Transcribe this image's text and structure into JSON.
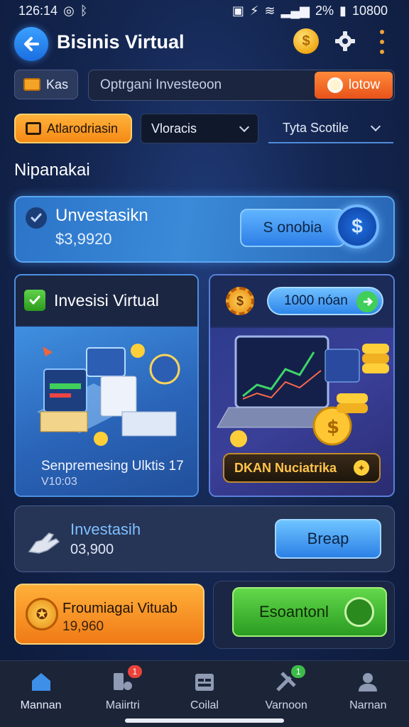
{
  "status_bar": {
    "time": "126:14",
    "battery": "2%",
    "extra": "10800"
  },
  "header": {
    "title": "Bisinis Virtual"
  },
  "search": {
    "chip_label": "Kas",
    "placeholder": "Optrgani Investeoon",
    "button_label": "lotow"
  },
  "filters": {
    "primary": "Atlarodriasin",
    "dropdown_1": "Vloracis",
    "dropdown_2": "Tyta Scotile"
  },
  "section": {
    "title": "Nipanakai"
  },
  "featured": {
    "title": "Unvestasikn",
    "amount": "$3,9920",
    "button_label": "S onobia"
  },
  "card_left": {
    "title": "Invesisi Virtual",
    "caption": "Senpremesing Ulktis 17",
    "sub": "V10:03"
  },
  "card_right": {
    "pill_label": "1000 nóan",
    "action_label": "DKAN Nuciatrika"
  },
  "investment": {
    "title": "Investasih",
    "amount": "03,900",
    "button_label": "Breap"
  },
  "promo": {
    "title": "Froumiagai Vituab",
    "amount": "19,960"
  },
  "action": {
    "button_label": "Esoantonl"
  },
  "nav": {
    "items": [
      {
        "label": "Mannan",
        "icon": "home-icon"
      },
      {
        "label": "Maiirtri",
        "icon": "devices-icon",
        "badge": "1"
      },
      {
        "label": "Coilal",
        "icon": "calendar-icon"
      },
      {
        "label": "Varnoon",
        "icon": "tools-icon",
        "badge": "1"
      },
      {
        "label": "Narnan",
        "icon": "profile-icon"
      }
    ]
  },
  "colors": {
    "accent_orange": "#f58a16",
    "accent_blue": "#2e7ee6",
    "accent_green": "#2a9c22",
    "background": "#142650"
  }
}
